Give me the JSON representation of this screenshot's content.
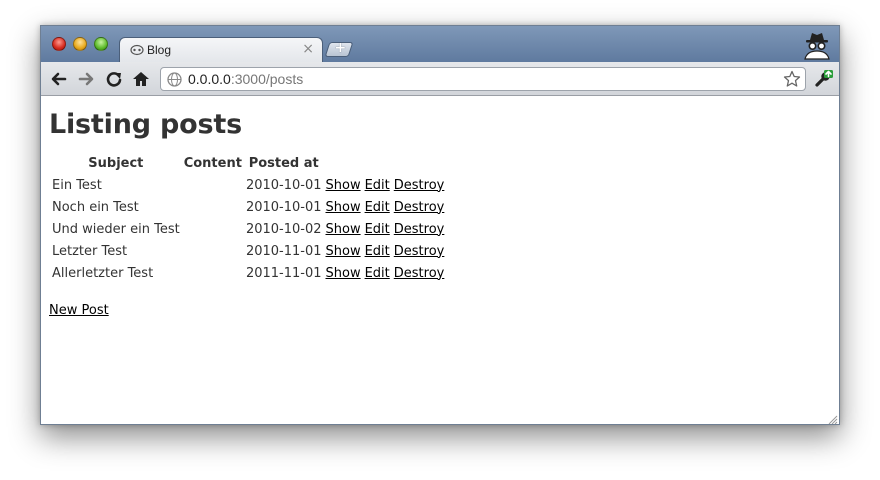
{
  "browser": {
    "tab_title": "Blog",
    "tab_close": "×",
    "new_tab": "+",
    "url_host": "0.0.0.0",
    "url_rest": ":3000/posts",
    "icons": [
      "back-icon",
      "forward-icon",
      "reload-icon",
      "home-icon",
      "globe-icon",
      "star-icon",
      "wrench-icon",
      "incognito-icon"
    ]
  },
  "page": {
    "title": "Listing posts",
    "columns": [
      "Subject",
      "Content",
      "Posted at"
    ],
    "rows": [
      {
        "subject": "Ein Test",
        "content": "",
        "posted_at": "2010-10-01",
        "show": "Show",
        "edit": "Edit",
        "destroy": "Destroy"
      },
      {
        "subject": "Noch ein Test",
        "content": "",
        "posted_at": "2010-10-01",
        "show": "Show",
        "edit": "Edit",
        "destroy": "Destroy"
      },
      {
        "subject": "Und wieder ein Test",
        "content": "",
        "posted_at": "2010-10-02",
        "show": "Show",
        "edit": "Edit",
        "destroy": "Destroy"
      },
      {
        "subject": "Letzter Test",
        "content": "",
        "posted_at": "2010-11-01",
        "show": "Show",
        "edit": "Edit",
        "destroy": "Destroy"
      },
      {
        "subject": "Allerletzter Test",
        "content": "",
        "posted_at": "2011-11-01",
        "show": "Show",
        "edit": "Edit",
        "destroy": "Destroy"
      }
    ],
    "new_post": "New Post"
  }
}
